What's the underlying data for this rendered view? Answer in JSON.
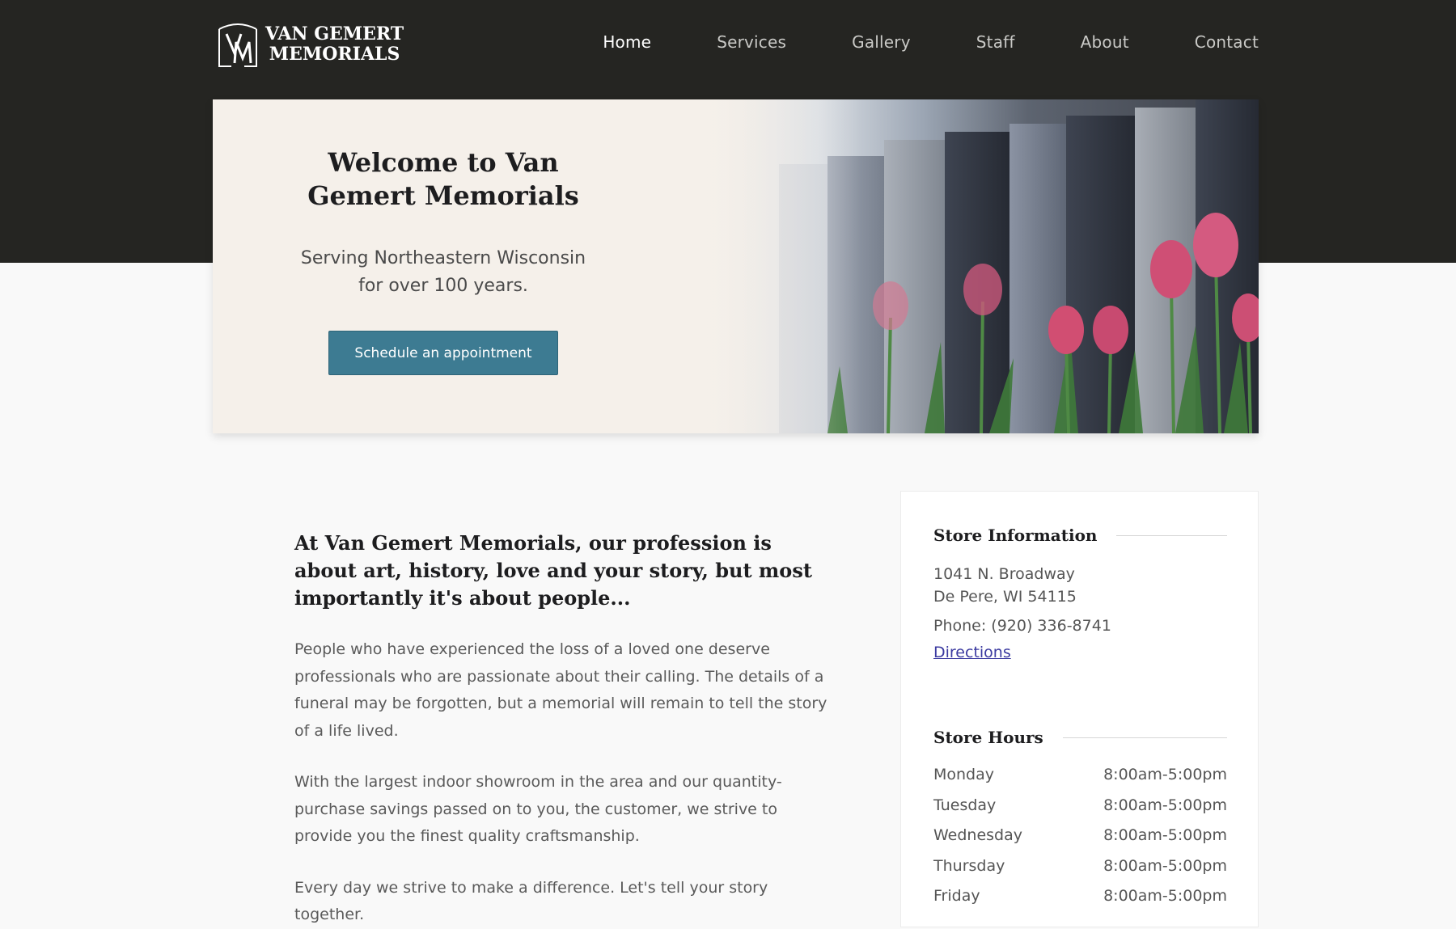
{
  "brand": {
    "logo_line1": "VAN GEMERT",
    "logo_line2": "MEMORIALS",
    "logo_monogram": "VM"
  },
  "nav": {
    "items": [
      {
        "label": "Home",
        "active": true
      },
      {
        "label": "Services"
      },
      {
        "label": "Gallery"
      },
      {
        "label": "Staff"
      },
      {
        "label": "About"
      },
      {
        "label": "Contact"
      }
    ]
  },
  "hero": {
    "title": "Welcome to Van Gemert Memorials",
    "subtitle_line1": "Serving Northeastern Wisconsin",
    "subtitle_line2": "for over 100 years.",
    "cta_label": "Schedule an appointment"
  },
  "intro": {
    "heading": "At Van Gemert Memorials, our profession is about art, history, love and your story, but most importantly it's about people...",
    "paragraphs": [
      "People who have experienced the loss of a loved one deserve professionals who are passionate about their calling. The details of a funeral may be forgotten, but a memorial will remain to tell the story of a life lived.",
      "With the largest indoor showroom in the area and our quantity-purchase savings passed on to you, the customer, we strive to provide you the finest quality craftsmanship.",
      "Every day we strive to make a difference. Let's tell your story together."
    ]
  },
  "store": {
    "info_title": "Store Information",
    "address_line1": "1041 N. Broadway",
    "address_line2": "De Pere, WI 54115",
    "phone": "Phone: (920) 336-8741",
    "directions_label": "Directions",
    "hours_title": "Store Hours",
    "hours": [
      {
        "day": "Monday",
        "time": "8:00am-5:00pm"
      },
      {
        "day": "Tuesday",
        "time": "8:00am-5:00pm"
      },
      {
        "day": "Wednesday",
        "time": "8:00am-5:00pm"
      },
      {
        "day": "Thursday",
        "time": "8:00am-5:00pm"
      },
      {
        "day": "Friday",
        "time": "8:00am-5:00pm"
      }
    ]
  },
  "colors": {
    "header_bg": "#252522",
    "accent": "#3d7b92",
    "link": "#3b3aa0",
    "page_bg": "#f9f9f9"
  }
}
